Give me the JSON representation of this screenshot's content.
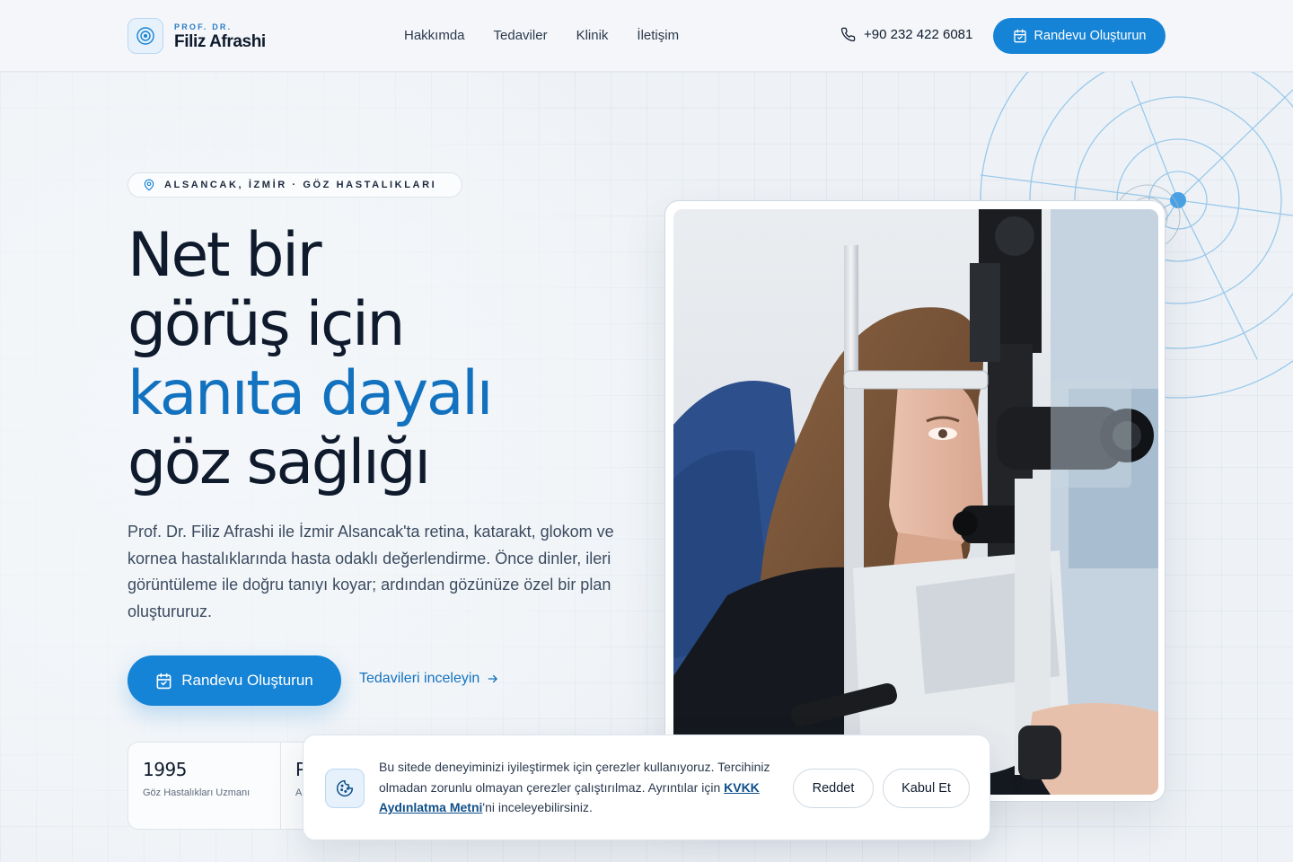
{
  "brand": {
    "title_small": "PROF. DR.",
    "name": "Filiz Afrashi",
    "accent_color": "#1583d6"
  },
  "nav": {
    "items": [
      {
        "label": "Hakkımda"
      },
      {
        "label": "Tedaviler"
      },
      {
        "label": "Klinik"
      },
      {
        "label": "İletişim"
      }
    ]
  },
  "header": {
    "phone": "+90 232 422 6081",
    "cta_label": "Randevu Oluşturun"
  },
  "hero": {
    "location_badge": "ALSANCAK, İZMİR · GÖZ HASTALIKLARI",
    "headline": {
      "line1": "Net bir",
      "line2": "görüş için",
      "line3_accent": "kanıta dayalı",
      "line4": "göz sağlığı"
    },
    "lead": "Prof. Dr. Filiz Afrashi ile İzmir Alsancak'ta retina, katarakt, glokom ve kornea hastalıklarında hasta odaklı değerlendirme. Önce dinler, ileri görüntüleme ile doğru tanıyı koyar; ardından gözünüze özel bir plan oluştururuz.",
    "cta_label": "Randevu Oluşturun",
    "secondary_link": "Tedavileri inceleyin"
  },
  "stats": [
    {
      "value": "1995",
      "label": "Göz Hastalıkları Uzmanı"
    },
    {
      "value": "P",
      "label": "A"
    }
  ],
  "cookie": {
    "text_before_link": "Bu sitede deneyiminizi iyileştirmek için çerezler kullanıyoruz. Tercihiniz olmadan zorunlu olmayan çerezler çalıştırılmaz. Ayrıntılar için ",
    "link_text": "KVKK Aydınlatma Metni",
    "text_after_link": "'ni inceleyebilirsiniz.",
    "reject_label": "Reddet",
    "accept_label": "Kabul Et"
  }
}
